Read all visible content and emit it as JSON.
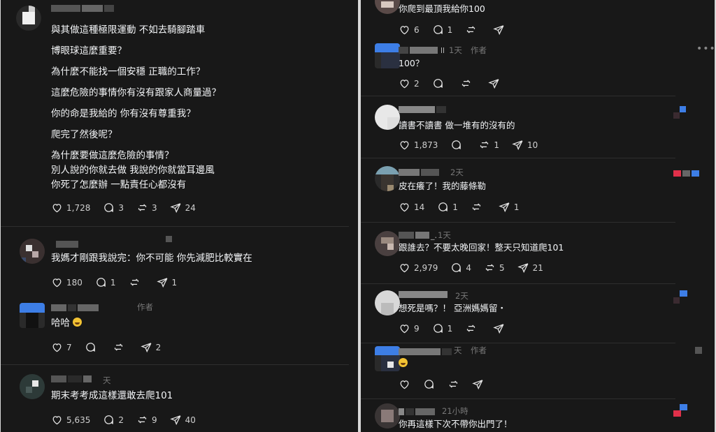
{
  "author_tag": "作者",
  "colors": {
    "background": "#181818",
    "text": "#f3f5f7",
    "muted": "#777777",
    "divider": "#2e2e2e"
  },
  "icons": {
    "like": "heart-icon",
    "reply": "comment-icon",
    "repost": "repost-icon",
    "share": "share-icon",
    "more": "more-options-icon"
  },
  "left_column": {
    "comments": [
      {
        "lines": [
          "與其做這種極限運動 不如去騎腳踏車",
          "博眼球這麼重要？",
          "為什麼不能找一個安穩 正職的工作？",
          "這麼危險的事情你有沒有跟家人商量過？",
          "你的命是我給的 你有沒有尊重我？",
          "爬完了然後呢？",
          "為什麼要做這麼危險的事情？",
          "別人說的你就去做 我說的你就當耳邊風",
          "你死了怎麼辦 一點責任心都沒有"
        ],
        "likes": "1,728",
        "replies": "3",
        "reposts": "3",
        "shares": "24"
      },
      {
        "lines": [
          "我媽才剛跟我說完：你不可能 你先減肥比較實在"
        ],
        "likes": "180",
        "replies": "1",
        "reposts": "",
        "shares": "1"
      },
      {
        "lines": [
          "哈哈"
        ],
        "author": true,
        "likes": "7",
        "replies": "",
        "reposts": "",
        "shares": "2"
      },
      {
        "lines": [
          "期末考考成這樣還敢去爬101"
        ],
        "time": "天",
        "likes": "5,635",
        "replies": "2",
        "reposts": "9",
        "shares": "40"
      }
    ]
  },
  "right_column": {
    "comments": [
      {
        "lines": [
          "你爬到最頂我給你100"
        ],
        "likes": "6",
        "replies": "1",
        "reposts": "",
        "shares": ""
      },
      {
        "lines": [
          "100？"
        ],
        "time": "1天",
        "author": true,
        "name_suffix": "ll",
        "likes": "2",
        "replies": "",
        "reposts": "",
        "shares": ""
      },
      {
        "lines": [
          "讀書不讀書 做一堆有的沒有的"
        ],
        "likes": "1,873",
        "replies": "",
        "reposts": "1",
        "shares": "10"
      },
      {
        "lines": [
          "皮在癢了！我的藤條勒"
        ],
        "time": "2天",
        "likes": "14",
        "replies": "1",
        "reposts": "",
        "shares": "1"
      },
      {
        "lines": [
          "跟誰去？不要太晚回家！整天只知道爬101"
        ],
        "time": "1天",
        "name_suffix": "_.",
        "likes": "2,979",
        "replies": "4",
        "reposts": "5",
        "shares": "21"
      },
      {
        "lines": [
          "想死是嗎？！ 亞洲媽媽留・"
        ],
        "time": "2天",
        "likes": "9",
        "replies": "1",
        "reposts": "",
        "shares": ""
      },
      {
        "lines": [
          ""
        ],
        "time": "天",
        "author": true,
        "likes": "",
        "replies": "",
        "reposts": "",
        "shares": ""
      },
      {
        "lines": [
          "你再這樣下次不帶你出門了！"
        ],
        "time": "21小時",
        "likes": "",
        "replies": "",
        "reposts": "",
        "shares": ""
      }
    ]
  }
}
